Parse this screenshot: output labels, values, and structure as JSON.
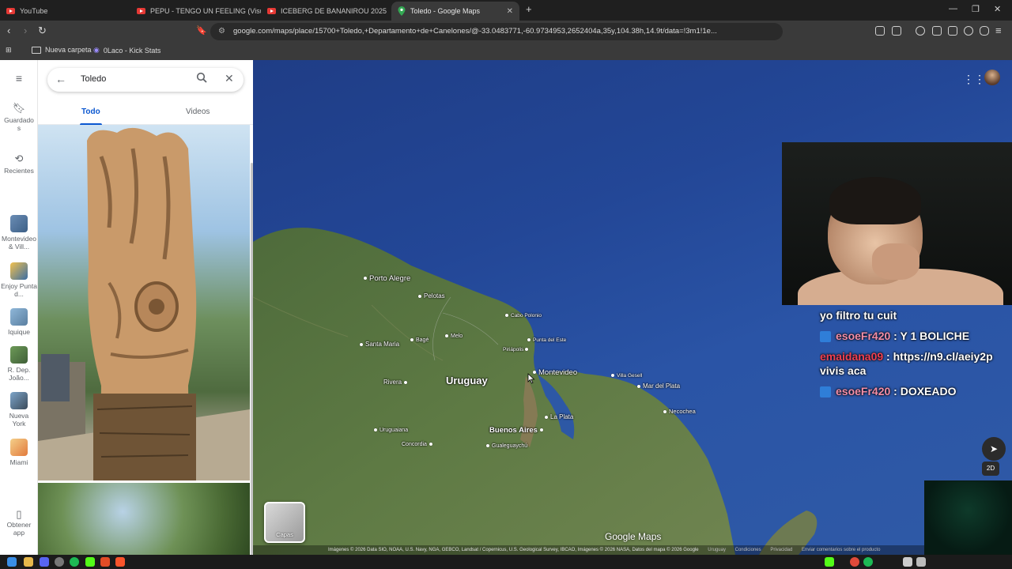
{
  "browser": {
    "tabs": [
      {
        "label": "YouTube",
        "active": false
      },
      {
        "label": "PEPU - TENGO UN FEELING (Visualiz",
        "active": false
      },
      {
        "label": "ICEBERG DE BANANIROU 2025",
        "active": false
      },
      {
        "label": "Toledo - Google Maps",
        "active": true
      }
    ],
    "url": "google.com/maps/place/15700+Toledo,+Departamento+de+Canelones/@-33.0483771,-60.9734953,2652404a,35y,104.38h,14.9t/data=!3m1!1e...",
    "bookmarks": [
      "Nueva carpeta",
      "0Laco - Kick Stats"
    ]
  },
  "rail": {
    "items": [
      {
        "label": "Guardados",
        "icon": "bookmark-icon"
      },
      {
        "label": "Recientes",
        "icon": "history-icon"
      },
      {
        "label": "Montevideo & Vill...",
        "icon": "thumbnail"
      },
      {
        "label": "Enjoy Punta d...",
        "icon": "thumbnail"
      },
      {
        "label": "Iquique",
        "icon": "thumbnail"
      },
      {
        "label": "R. Dep. João...",
        "icon": "thumbnail"
      },
      {
        "label": "Nueva York",
        "icon": "thumbnail"
      },
      {
        "label": "Miami",
        "icon": "thumbnail"
      },
      {
        "label": "Obtener app",
        "icon": "phone-icon"
      }
    ]
  },
  "search": {
    "query": "Toledo"
  },
  "panel_tabs": {
    "all": "Todo",
    "videos": "Videos"
  },
  "map": {
    "labels": {
      "porto_alegre": "Porto Alegre",
      "pelotas": "Pelotas",
      "cabo_polonio": "Cabo Polonio",
      "melo": "Melo",
      "punta_del_este": "Punta del Este",
      "santa_maria": "Santa Maria",
      "bage": "Bagé",
      "piriapolis": "Piriápolis",
      "montevideo": "Montevideo",
      "villa_gesell": "Villa Gesell",
      "rivera": "Rivera",
      "uruguay": "Uruguay",
      "mar_del_plata": "Mar del Plata",
      "necochea": "Necochea",
      "la_plata": "La Plata",
      "buenos_aires": "Buenos Aires",
      "uruguaiana": "Uruguaiana",
      "concordia": "Concordia",
      "gualeguaychu": "Gualeguaychú"
    },
    "layers_label": "Capas",
    "brand": "Google Maps",
    "attribution": "Imágenes © 2026 Data SIO, NOAA, U.S. Navy, NGA, GEBCO, Landsat / Copernicus, U.S. Geological Survey, IBCAO, Imágenes © 2026 NASA, Datos del mapa © 2026 Google",
    "footer_links": [
      "Uruguay",
      "Condiciones",
      "Privacidad",
      "Enviar comentarios sobre el producto"
    ],
    "view_mode": "2D"
  },
  "chat": {
    "messages": [
      {
        "user": "",
        "text": "yo filtro tu cuit"
      },
      {
        "user": "esoeFr420",
        "text": " : Y 1 BOLICHE"
      },
      {
        "user": "emaidana09",
        "text": " : https://n9.cl/aeiy2p"
      },
      {
        "user": "",
        "text": "vivis aca"
      },
      {
        "user": "esoeFr420",
        "text": " : DOXEADO"
      }
    ]
  },
  "colors": {
    "accent": "#0b57d0",
    "map_ocean": "#2a54a6",
    "chat_user": "#f38ea8"
  }
}
